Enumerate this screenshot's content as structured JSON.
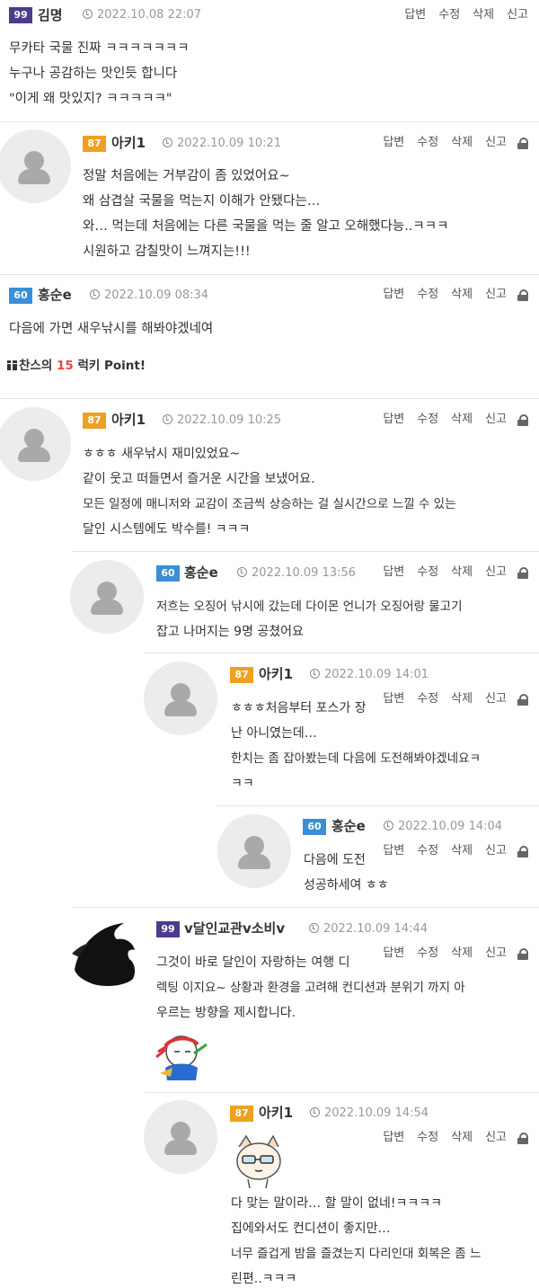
{
  "actions": {
    "reply": "답변",
    "edit": "수정",
    "delete": "삭제",
    "report": "신고"
  },
  "comments": [
    {
      "level": "99",
      "nick": "김명",
      "date": "2022.10.08 22:07",
      "lines": [
        "무카타 국물 진짜 ㅋㅋㅋㅋㅋㅋㅋ",
        "누구나 공감하는 맛인듯 합니다",
        "\"이게 왜 맛있지? ㅋㅋㅋㅋㅋ\""
      ]
    },
    {
      "level": "87",
      "nick": "아키1",
      "date": "2022.10.09 10:21",
      "lines": [
        "정말 처음에는 거부감이 좀 있었어요~",
        "왜 삼겹살 국물을 먹는지 이해가 안됐다는…",
        "와… 먹는데 처음에는 다른 국물을 먹는 줄 알고 오해했다능..ㅋㅋㅋ",
        "시원하고 감칠맛이 느껴지는!!!"
      ]
    },
    {
      "level": "60",
      "nick": "홍순e",
      "date": "2022.10.09 08:34",
      "lines": [
        "다음에 가면 새우낚시를 해봐야겠네여"
      ],
      "lucky": {
        "prefix": "찬스의",
        "num": "15",
        "suffix": "럭키 Point!"
      }
    },
    {
      "level": "87",
      "nick": "아키1",
      "date": "2022.10.09 10:25",
      "lines": [
        "ㅎㅎㅎ 새우낚시 재미있었요~",
        "같이 웃고 떠들면서 즐거운 시간을 보냈어요.",
        "모든 일정에 매니저와 교감이 조금씩 상승하는 걸 실시간으로 느낄 수 있는",
        "달인 시스템에도 박수를! ㅋㅋㅋ"
      ]
    },
    {
      "level": "60",
      "nick": "홍순e",
      "date": "2022.10.09 13:56",
      "lines": [
        "저흐는 오징어 낚시에 갔는데 다이몬 언니가 오징어랑 물고기",
        "잡고 나머지는 9명 공쳤어요"
      ]
    },
    {
      "level": "87",
      "nick": "아키1",
      "date": "2022.10.09 14:01",
      "lines": [
        "ㅎㅎㅎ처음부터 포스가 장",
        "난 아니였는데…",
        "한치는 좀 잡아봤는데 다음에 도전해봐야겠네요ㅋ",
        "ㅋㅋ"
      ]
    },
    {
      "level": "60",
      "nick": "홍순e",
      "date": "2022.10.09 14:04",
      "lines": [
        "다음에 도전",
        "성공하세여 ㅎㅎ"
      ]
    },
    {
      "level": "99",
      "nick": "v달인교관v소비v",
      "date": "2022.10.09 14:44",
      "lines": [
        "그것이 바로 달인이 자랑하는 여행 디",
        "렉팅 이지요~ 상황과 환경을 고려해 컨디션과 분위기 까지 아",
        "우르는 방향을 제시합니다."
      ]
    },
    {
      "level": "87",
      "nick": "아키1",
      "date": "2022.10.09 14:54",
      "lines": [
        "다 맞는 말이라… 할 말이 없네!ㅋㅋㅋㅋ",
        "집에와서도 컨디션이 좋지만…",
        "너무 즐겁게 밤을 즐겼는지 다리인대 회복은 좀 느",
        "린편..ㅋㅋㅋ"
      ]
    }
  ],
  "colors": {
    "level_99": "#4e3b8b",
    "level_87": "#f0a020",
    "level_60": "#3a8fd8",
    "lucky_num": "#e44444"
  }
}
